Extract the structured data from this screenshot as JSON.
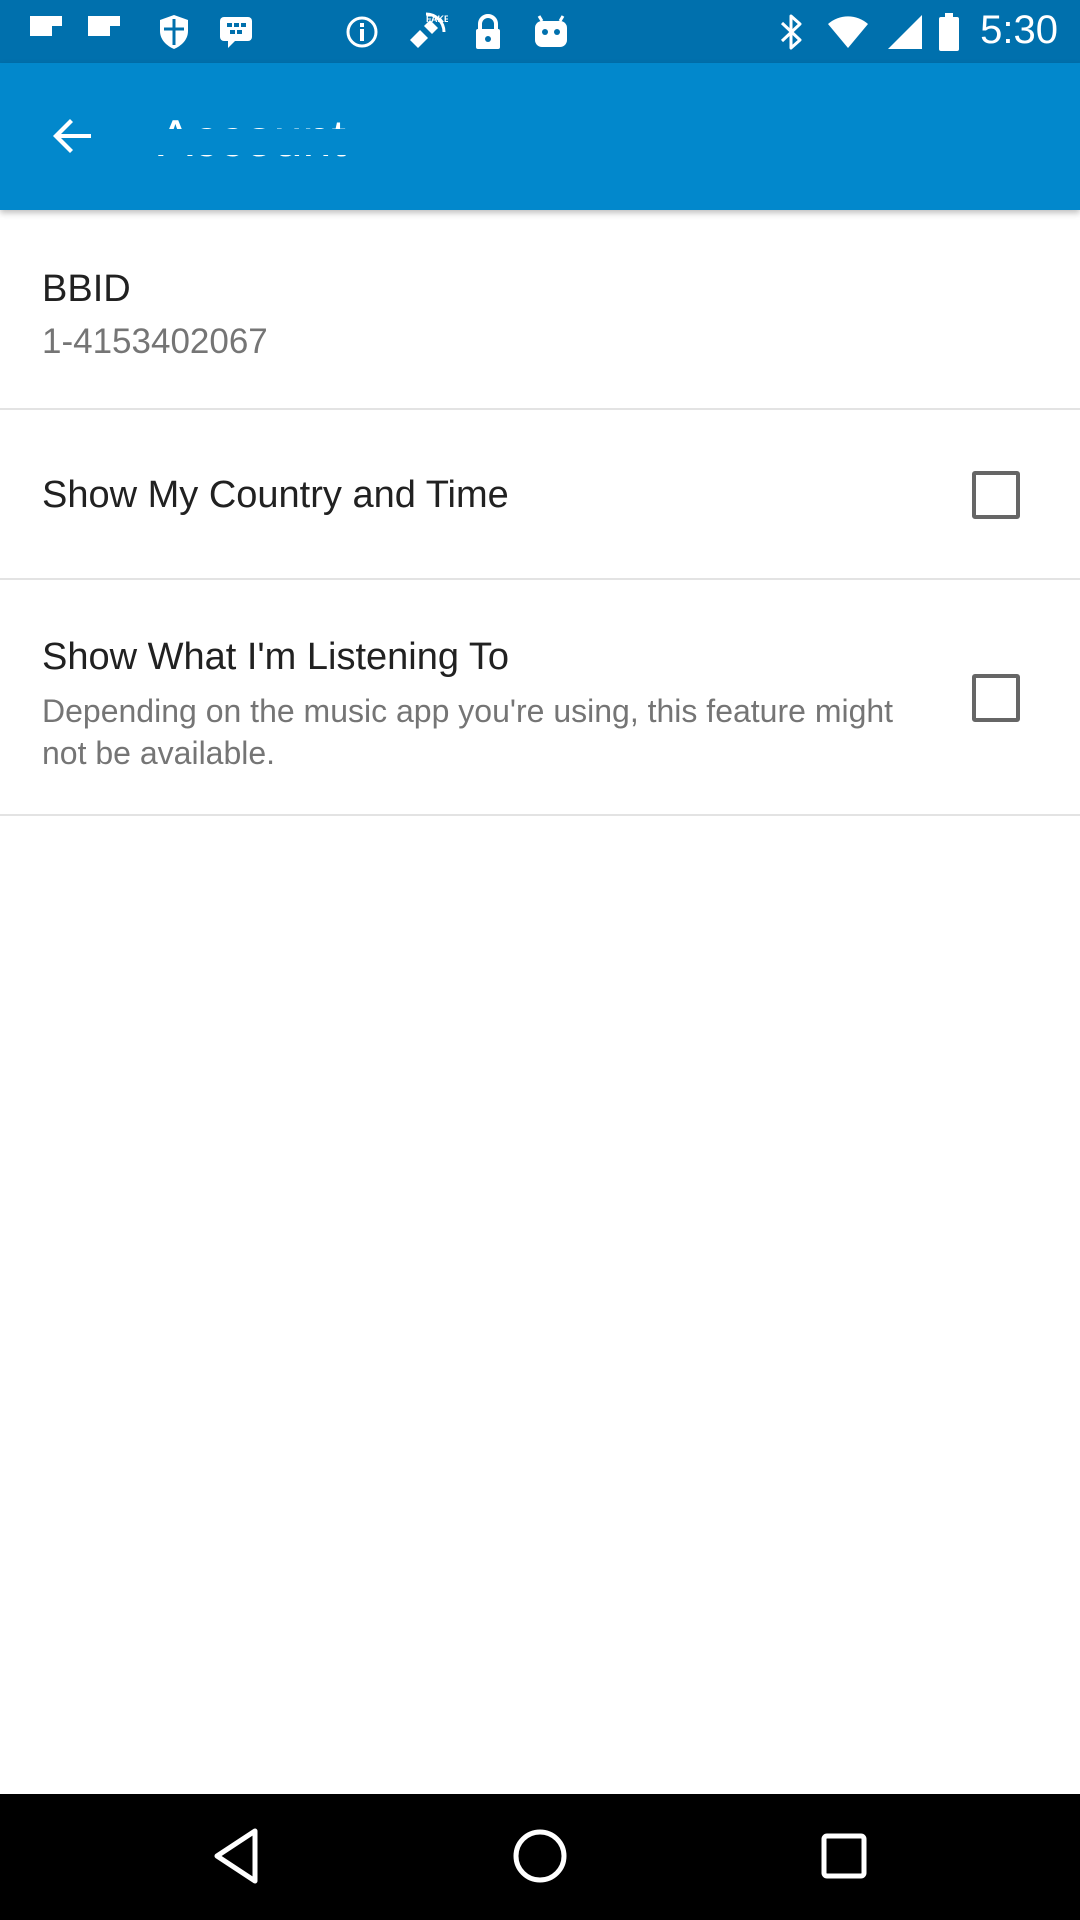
{
  "status_bar": {
    "time": "5:30",
    "icons": [
      "flipboard-icon",
      "flipboard-icon",
      "shield-icon",
      "blackberry-messenger-icon",
      "info-icon",
      "fake-gps-icon",
      "lock-icon",
      "android-icon",
      "bluetooth-icon",
      "wifi-icon",
      "signal-icon",
      "battery-icon"
    ]
  },
  "app_bar": {
    "title": "Account",
    "back_icon": "arrow-back-icon",
    "background_color": "#0288cc"
  },
  "account": {
    "bbid_label": "BBID",
    "bbid_value": "1-4153402067"
  },
  "settings": [
    {
      "label": "Show My Country and Time",
      "description": "",
      "checked": false
    },
    {
      "label": "Show What I'm Listening To",
      "description": "Depending on the music app you're using, this feature might not be available.",
      "checked": false
    }
  ],
  "nav_bar": {
    "icons": [
      "back-triangle-icon",
      "home-circle-icon",
      "recents-square-icon"
    ]
  }
}
